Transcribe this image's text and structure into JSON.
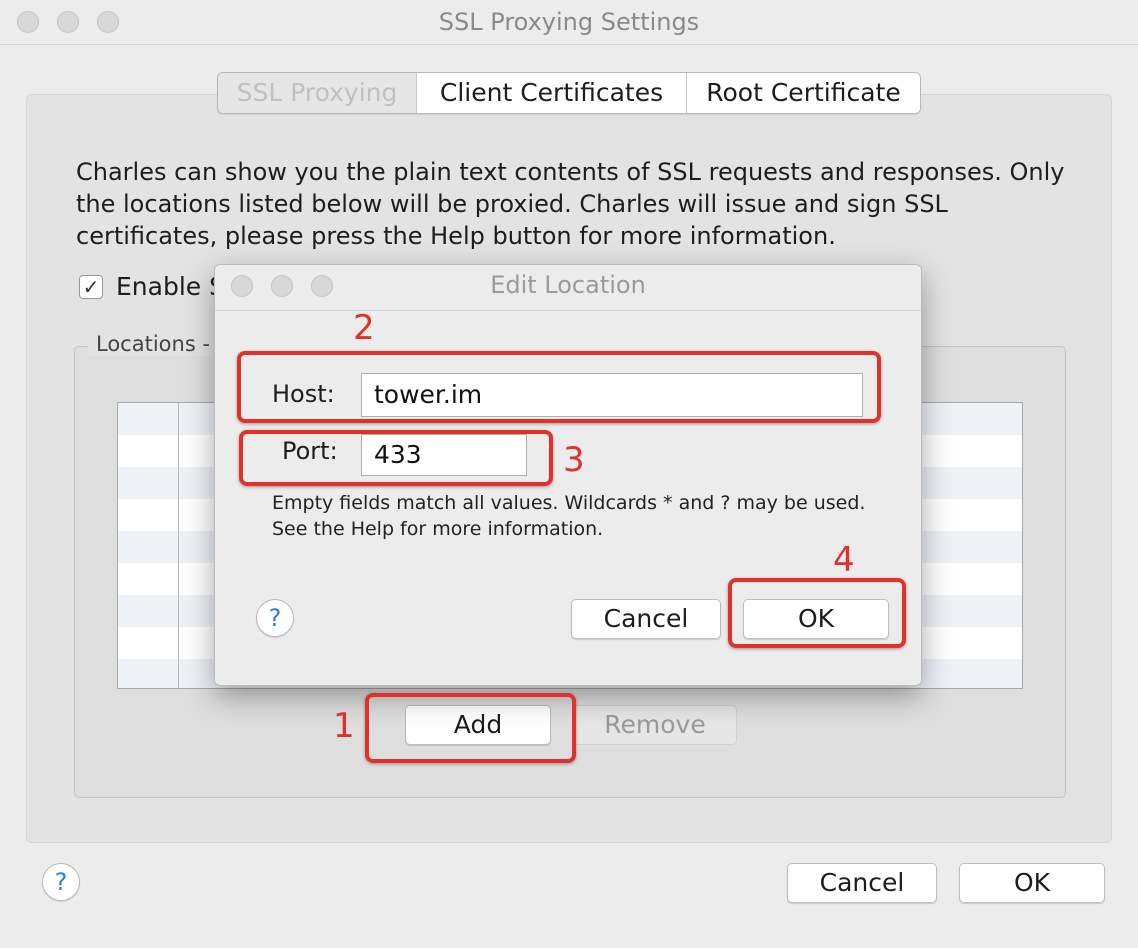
{
  "window": {
    "title": "SSL Proxying Settings"
  },
  "tabs": [
    {
      "label": "SSL Proxying",
      "active": true
    },
    {
      "label": "Client Certificates",
      "active": false
    },
    {
      "label": "Root Certificate",
      "active": false
    }
  ],
  "description": "Charles can show you the plain text contents of SSL requests and responses. Only the locations listed below will be proxied. Charles will issue and sign SSL certificates, please press the Help button for more information.",
  "enable": {
    "checked": true,
    "label": "Enable S"
  },
  "locations": {
    "label": "Locations",
    "label_trunc": "Locations -"
  },
  "buttons": {
    "add": "Add",
    "remove": "Remove",
    "cancel": "Cancel",
    "ok": "OK",
    "help": "?"
  },
  "dialog": {
    "title": "Edit Location",
    "host_label": "Host:",
    "host_value": "tower.im",
    "port_label": "Port:",
    "port_value": "433",
    "hint": "Empty fields match all values. Wildcards * and ? may be used. See the Help for more information.",
    "cancel": "Cancel",
    "ok": "OK",
    "help": "?"
  },
  "annotations": [
    "1",
    "2",
    "3",
    "4"
  ],
  "colors": {
    "annotation": "#e0322a",
    "help_icon": "#2d7be0"
  }
}
